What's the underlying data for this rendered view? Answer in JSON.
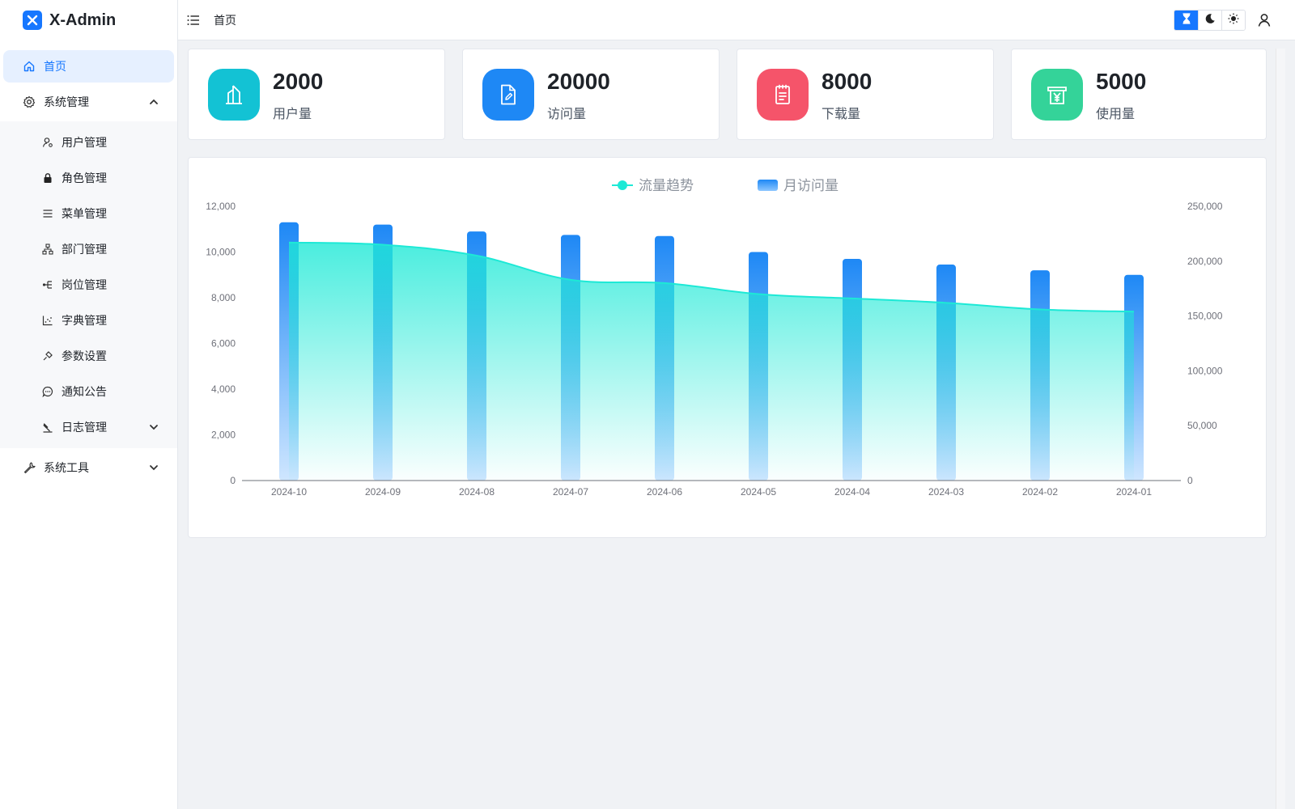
{
  "app": {
    "title": "X-Admin"
  },
  "header": {
    "breadcrumb": "首页"
  },
  "sidebar": {
    "home": "首页",
    "system": {
      "label": "系统管理",
      "items": [
        {
          "label": "用户管理",
          "icon": "user-manage-icon"
        },
        {
          "label": "角色管理",
          "icon": "lock-icon"
        },
        {
          "label": "菜单管理",
          "icon": "list-icon"
        },
        {
          "label": "部门管理",
          "icon": "org-tree-icon"
        },
        {
          "label": "岗位管理",
          "icon": "post-icon"
        },
        {
          "label": "字典管理",
          "icon": "dict-icon"
        },
        {
          "label": "参数设置",
          "icon": "plug-icon"
        },
        {
          "label": "通知公告",
          "icon": "message-icon"
        },
        {
          "label": "日志管理",
          "icon": "log-icon"
        }
      ]
    },
    "tools": {
      "label": "系统工具"
    }
  },
  "stats": [
    {
      "value": "2000",
      "label": "用户量",
      "color": "#13c2d4"
    },
    {
      "value": "20000",
      "label": "访问量",
      "color": "#1e88f5"
    },
    {
      "value": "8000",
      "label": "下载量",
      "color": "#f5546a"
    },
    {
      "value": "5000",
      "label": "使用量",
      "color": "#34d399"
    }
  ],
  "chart_data": {
    "type": "bar",
    "categories": [
      "2024-10",
      "2024-09",
      "2024-08",
      "2024-07",
      "2024-06",
      "2024-05",
      "2024-04",
      "2024-03",
      "2024-02",
      "2024-01"
    ],
    "series": [
      {
        "name": "月访问量",
        "type": "bar",
        "axis": "left",
        "values": [
          11300,
          11200,
          10900,
          10750,
          10700,
          10000,
          9700,
          9450,
          9200,
          9000
        ]
      },
      {
        "name": "流量趋势",
        "type": "area",
        "axis": "right",
        "values": [
          217000,
          215000,
          205000,
          183000,
          180000,
          170000,
          166000,
          162000,
          156000,
          154000
        ]
      }
    ],
    "y_left": {
      "min": 0,
      "max": 12000,
      "ticks": [
        "0",
        "2,000",
        "4,000",
        "6,000",
        "8,000",
        "10,000",
        "12,000"
      ]
    },
    "y_right": {
      "min": 0,
      "max": 250000,
      "ticks": [
        "0",
        "50,000",
        "100,000",
        "150,000",
        "200,000",
        "250,000"
      ]
    },
    "legend": "top-center",
    "colors": {
      "bar": "#1e88f5",
      "line": "#1de9d6"
    }
  }
}
